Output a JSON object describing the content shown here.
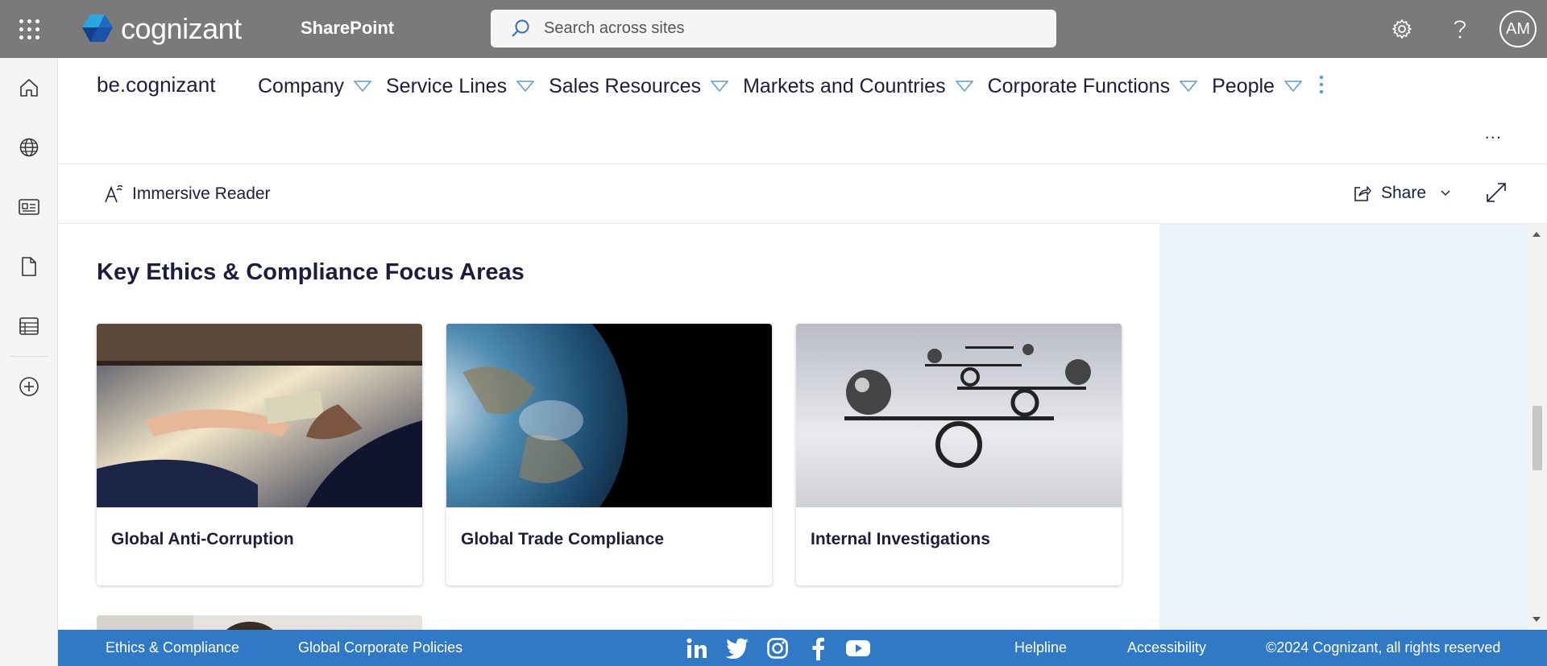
{
  "suitebar": {
    "brand": "cognizant",
    "app_name": "SharePoint",
    "search_placeholder": "Search across sites",
    "avatar_initials": "AM",
    "background": "#7a7a7a"
  },
  "appbar": {
    "items": [
      {
        "icon": "home-icon"
      },
      {
        "icon": "globe-icon"
      },
      {
        "icon": "news-icon"
      },
      {
        "icon": "document-icon"
      },
      {
        "icon": "list-icon"
      },
      {
        "icon": "add-circle-icon"
      }
    ]
  },
  "sitenav": {
    "site_title": "be.cognizant",
    "items": [
      {
        "label": "Company"
      },
      {
        "label": "Service Lines"
      },
      {
        "label": "Sales Resources"
      },
      {
        "label": "Markets and Countries"
      },
      {
        "label": "Corporate Functions"
      },
      {
        "label": "People"
      }
    ],
    "more": "..."
  },
  "cmdbar": {
    "immersive_reader": "Immersive Reader",
    "share": "Share"
  },
  "content": {
    "section_title": "Key Ethics & Compliance Focus Areas",
    "cards": [
      {
        "title": "Global Anti-Corruption"
      },
      {
        "title": "Global Trade Compliance"
      },
      {
        "title": "Internal Investigations"
      }
    ]
  },
  "footer": {
    "links": [
      "Ethics & Compliance",
      "Global Corporate Policies"
    ],
    "right_links": [
      "Helpline",
      "Accessibility"
    ],
    "copyright": "©2024 Cognizant, all rights reserved",
    "social": [
      "linkedin-icon",
      "twitter-icon",
      "instagram-icon",
      "facebook-icon",
      "youtube-icon"
    ],
    "background": "#2f79c6"
  },
  "colors": {
    "text_primary": "#1d1d3f",
    "panel_bg": "#eaf2fb",
    "nav_chevron": "#5b9bd5"
  }
}
